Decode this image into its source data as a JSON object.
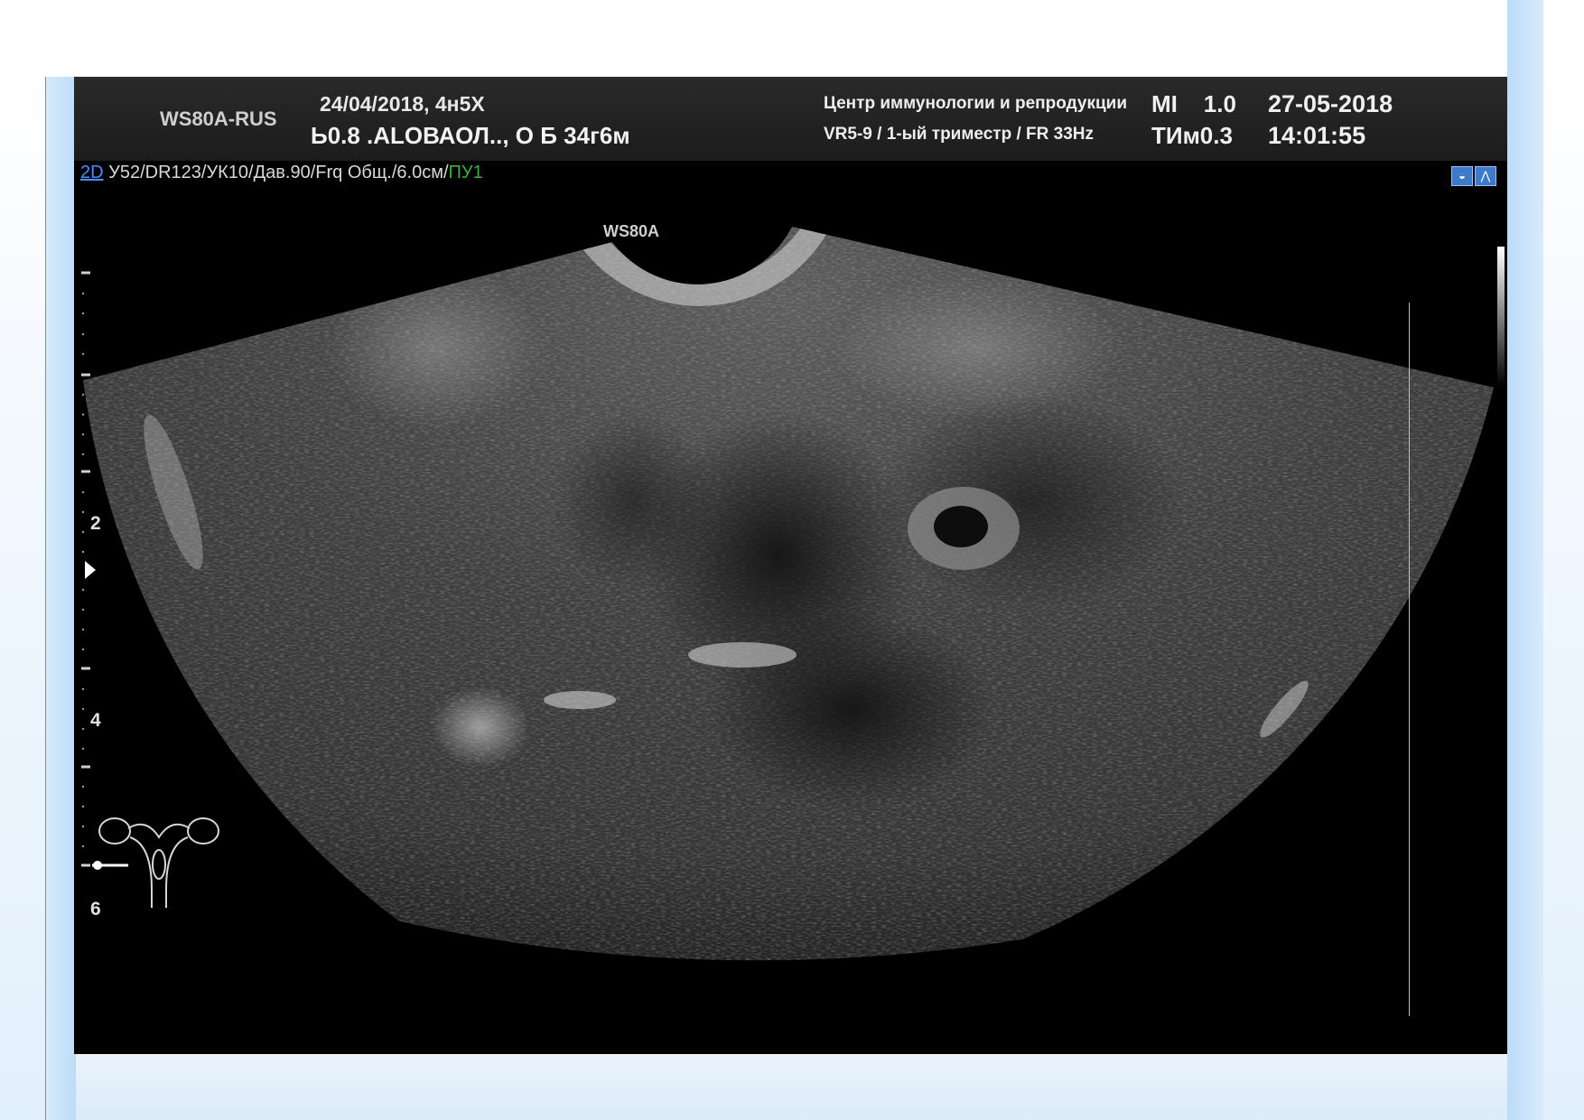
{
  "header": {
    "model": "WS80A-RUS",
    "exam_date": "24/04/2018, 4н5Х",
    "patient": "Ь0.8 .АLОВАОЛ.., О Б 34г6м",
    "center": "Центр иммунологии и репродукции",
    "probe_info": "VR5-9 / 1-ый триместр / FR 33Hz",
    "mi_label": "MI",
    "mi_value": "1.0",
    "ti_label": "ТИм0.3",
    "date": "27-05-2018",
    "time": "14:01:55"
  },
  "params": {
    "mode": "2D",
    "settings": " У52/DR123/УК10/Дав.90/Frq Общ./6.0см/",
    "preset": "ПУ1"
  },
  "image": {
    "probe_label": "WS80A",
    "depth_marks": [
      "2",
      "4",
      "6"
    ],
    "icons": [
      "probe-orientation-icon",
      "image-mode-icon"
    ]
  },
  "colors": {
    "screen_bg": "#000000",
    "header_bg": "#222222",
    "mode_link": "#4d8cff",
    "preset_text": "#3fae3f",
    "slide_accent": "#bcdcf8"
  }
}
